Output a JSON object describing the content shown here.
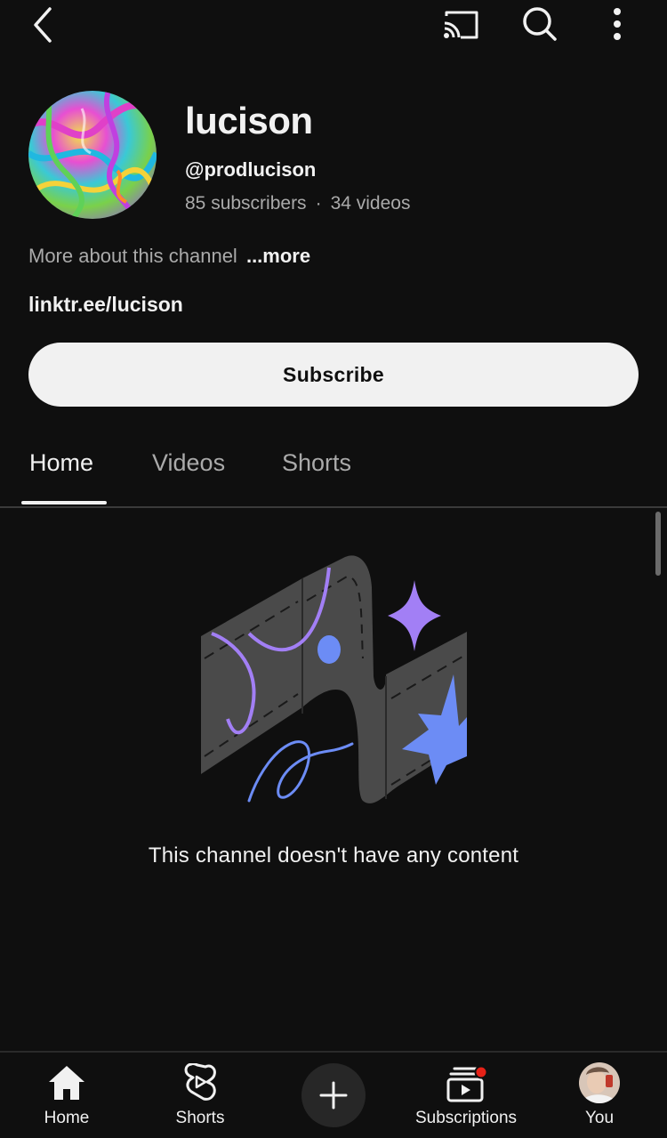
{
  "topbar": {
    "back_icon": "chevron-left-icon",
    "cast_icon": "cast-icon",
    "search_icon": "search-icon",
    "menu_icon": "more-vertical-icon"
  },
  "channel": {
    "name": "lucison",
    "handle": "@prodlucison",
    "subscribers": "85 subscribers",
    "separator": "·",
    "videos": "34 videos",
    "about": "More about this channel",
    "more": "...more",
    "link": "linktr.ee/lucison"
  },
  "subscribe_label": "Subscribe",
  "tabs": [
    {
      "label": "Home",
      "active": true
    },
    {
      "label": "Videos",
      "active": false
    },
    {
      "label": "Shorts",
      "active": false
    }
  ],
  "empty_state": {
    "message": "This channel doesn't have any content"
  },
  "bottom_nav": {
    "home": "Home",
    "shorts": "Shorts",
    "create_icon": "plus-icon",
    "subscriptions": "Subscriptions",
    "you": "You"
  },
  "colors": {
    "background": "#0f0f0f",
    "text": "#f1f1f1",
    "secondary_text": "#aaaaaa",
    "button_bg": "#f1f1f1",
    "notification_dot": "#e62117",
    "illustration_purple": "#a27ff5",
    "illustration_blue": "#6c8cf5"
  }
}
